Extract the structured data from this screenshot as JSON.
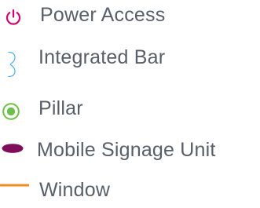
{
  "legend": {
    "items": [
      {
        "label": "Power Access",
        "icon": "power-icon",
        "color": "#d6006e"
      },
      {
        "label": "Integrated Bar",
        "icon": "bracket-icon",
        "color": "#4fb3e6"
      },
      {
        "label": "Pillar",
        "icon": "pillar-icon",
        "color": "#6dbf4b"
      },
      {
        "label": "Mobile Signage Unit",
        "icon": "signage-icon",
        "color": "#800c5c"
      },
      {
        "label": "Window",
        "icon": "window-line-icon",
        "color": "#f28a1c"
      }
    ],
    "text_color": "#585f68"
  }
}
